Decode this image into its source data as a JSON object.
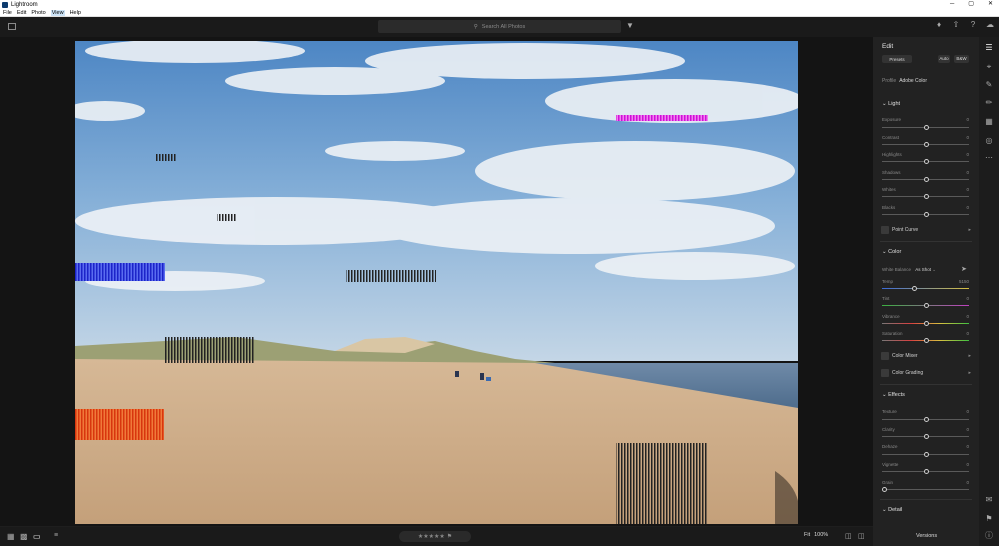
{
  "window": {
    "title": "Lightroom",
    "buttons": [
      "─",
      "▢",
      "✕"
    ]
  },
  "menu": {
    "items": [
      "File",
      "Edit",
      "Photo",
      "View",
      "Help"
    ],
    "active": "View"
  },
  "search": {
    "placeholder": "Search All Photos"
  },
  "edit_panel": {
    "title": "Edit",
    "preset_label": "Presets",
    "auto_label": "Auto",
    "bw_label": "B&W",
    "profile_label": "Profile",
    "profile_value": "Adobe Color",
    "light": {
      "title": "Light",
      "sliders": [
        {
          "label": "Exposure",
          "value": "0"
        },
        {
          "label": "Contrast",
          "value": "0"
        },
        {
          "label": "Highlights",
          "value": "0"
        },
        {
          "label": "Shadows",
          "value": "0"
        },
        {
          "label": "Whites",
          "value": "0"
        },
        {
          "label": "Blacks",
          "value": "0"
        }
      ],
      "point_curve": "Point Curve"
    },
    "color": {
      "title": "Color",
      "white_balance_label": "White Balance",
      "white_balance_value": "As Shot",
      "sliders": [
        {
          "label": "Temp",
          "value": "5150"
        },
        {
          "label": "Tint",
          "value": "0"
        },
        {
          "label": "Vibrance",
          "value": "0"
        },
        {
          "label": "Saturation",
          "value": "0"
        }
      ],
      "color_mixer": "Color Mixer",
      "color_grading": "Color Grading"
    },
    "effects": {
      "title": "Effects",
      "sliders": [
        {
          "label": "Texture",
          "value": "0"
        },
        {
          "label": "Clarity",
          "value": "0"
        },
        {
          "label": "Dehaze",
          "value": "0"
        },
        {
          "label": "Vignette",
          "value": "0"
        },
        {
          "label": "Grain",
          "value": "0"
        }
      ]
    },
    "detail": {
      "title": "Detail"
    }
  },
  "bottom": {
    "stars": "★★★★★",
    "fit_label": "Fit",
    "zoom_label": "100%",
    "versions_label": "Versions"
  }
}
